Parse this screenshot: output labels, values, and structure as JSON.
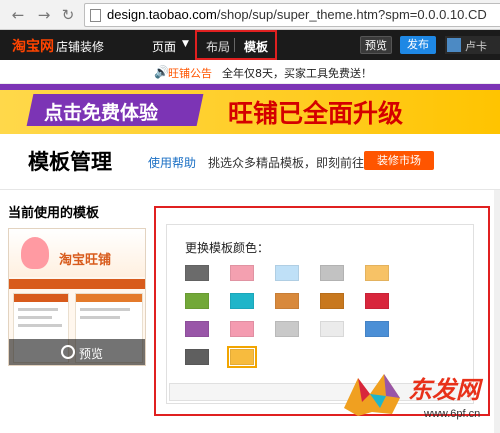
{
  "browser": {
    "url_host": "design.taobao.com",
    "url_path": "/shop/sup/super_theme.htm?spm=0.0.0.10.CD"
  },
  "topbar": {
    "logo": "淘宝网",
    "logo_sub": "店铺装修",
    "menu_page": "页面",
    "tab_layout": "布局",
    "tab_template": "模板",
    "btn_preview": "预览",
    "btn_publish": "发布",
    "user_name": "卢卡"
  },
  "notice": {
    "label": "旺铺公告",
    "text": "全年仅8天，买家工具免费送！"
  },
  "banner": {
    "left_text": "点击免费体验",
    "right_text": "旺铺已全面升级"
  },
  "header": {
    "title": "模板管理",
    "help_link": "使用帮助",
    "hint": "挑选众多精品模板，即刻前往",
    "market_button": "装修市场"
  },
  "current_template": {
    "label": "当前使用的模板",
    "preview_label": "预览",
    "thumb_brand": "淘宝旺铺"
  },
  "color_panel": {
    "title": "更换模板颜色：",
    "swatches": [
      "#6b6b6b",
      "#f4a0b0",
      "#bfe0f7",
      "#c2c2c2",
      "#f7c266",
      "#72a838",
      "#1fb5c9",
      "#d8893c",
      "#c8781e",
      "#d8263c",
      "#9956a8",
      "#f49bb0",
      "#c9c9c9",
      "#ebebeb",
      "#4b8fd6",
      "#5f5f5f",
      "#f7bb3e"
    ],
    "selected_index": 16
  },
  "watermark": {
    "brand": "东发网",
    "url": "www.6pf.cn"
  },
  "colors": {
    "accent_orange": "#ff5500",
    "highlight_red": "#e02020",
    "topbar_bg": "#1b1b1b",
    "publish_blue": "#1e88e5"
  }
}
